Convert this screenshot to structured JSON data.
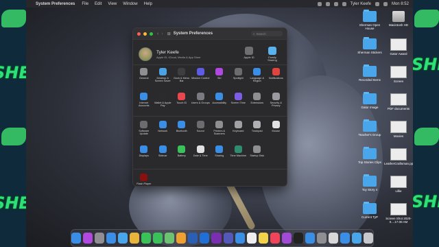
{
  "menubar": {
    "app_name": "System Preferences",
    "menus": [
      "File",
      "Edit",
      "View",
      "Window",
      "Help"
    ],
    "user_name": "Tyler Keefe",
    "clock": "Mon 8:52"
  },
  "overlay_text": "SHERMAN",
  "window": {
    "title": "System Preferences",
    "search_placeholder": "Search",
    "account": {
      "name": "Tyler Keefe",
      "subtitle": "Apple ID, iCloud, Media & App Store",
      "buttons": [
        {
          "label": "Apple ID",
          "icon": "apple-id-icon",
          "color": "#6e6e73"
        },
        {
          "label": "Family Sharing",
          "icon": "family-sharing-icon",
          "color": "#5ab2ee"
        }
      ]
    },
    "rows": [
      [
        {
          "label": "General",
          "icon": "general-icon",
          "color": "#8e8e93"
        },
        {
          "label": "Desktop & Screen Saver",
          "icon": "desktop-screensaver-icon",
          "color": "#4ba3e3"
        },
        {
          "label": "Dock & Menu Bar",
          "icon": "dock-menubar-icon",
          "color": "#3d3d42"
        },
        {
          "label": "Mission Control",
          "icon": "mission-control-icon",
          "color": "#5e5ce6"
        },
        {
          "label": "Siri",
          "icon": "siri-icon",
          "color": "#b148e0"
        },
        {
          "label": "Spotlight",
          "icon": "spotlight-icon",
          "color": "#6b6b70"
        },
        {
          "label": "Language & Region",
          "icon": "language-region-icon",
          "color": "#3a8ee6"
        },
        {
          "label": "Notifications",
          "icon": "notifications-icon",
          "color": "#e0443e"
        }
      ],
      [
        {
          "label": "Internet Accounts",
          "icon": "internet-accounts-icon",
          "color": "#3a8ee6"
        },
        {
          "label": "Wallet & Apple Pay",
          "icon": "wallet-icon",
          "color": "#2b2b2e"
        },
        {
          "label": "Touch ID",
          "icon": "touch-id-icon",
          "color": "#e8484d"
        },
        {
          "label": "Users & Groups",
          "icon": "users-groups-icon",
          "color": "#7a7a80"
        },
        {
          "label": "Accessibility",
          "icon": "accessibility-icon",
          "color": "#3a8ee6"
        },
        {
          "label": "Screen Time",
          "icon": "screen-time-icon",
          "color": "#7d5ce6"
        },
        {
          "label": "Extensions",
          "icon": "extensions-icon",
          "color": "#8e8e93"
        },
        {
          "label": "Security & Privacy",
          "icon": "security-privacy-icon",
          "color": "#9a9aa0"
        }
      ],
      [
        {
          "label": "Software Update",
          "icon": "software-update-icon",
          "color": "#6b6b70"
        },
        {
          "label": "Network",
          "icon": "network-icon",
          "color": "#3a8ee6"
        },
        {
          "label": "Bluetooth",
          "icon": "bluetooth-icon",
          "color": "#3a8ee6"
        },
        {
          "label": "Sound",
          "icon": "sound-icon",
          "color": "#6b6b70"
        },
        {
          "label": "Printers & Scanners",
          "icon": "printers-scanners-icon",
          "color": "#8e8e93"
        },
        {
          "label": "Keyboard",
          "icon": "keyboard-icon",
          "color": "#a0a0a5"
        },
        {
          "label": "Trackpad",
          "icon": "trackpad-icon",
          "color": "#b0b0b5"
        },
        {
          "label": "Mouse",
          "icon": "mouse-icon",
          "color": "#e0e0e5"
        }
      ],
      [
        {
          "label": "Displays",
          "icon": "displays-icon",
          "color": "#3a8ee6"
        },
        {
          "label": "Sidecar",
          "icon": "sidecar-icon",
          "color": "#3a8ee6"
        },
        {
          "label": "Battery",
          "icon": "battery-icon",
          "color": "#3ac15a"
        },
        {
          "label": "Date & Time",
          "icon": "date-time-icon",
          "color": "#e0e0e5"
        },
        {
          "label": "Sharing",
          "icon": "sharing-icon",
          "color": "#3a8ee6"
        },
        {
          "label": "Time Machine",
          "icon": "time-machine-icon",
          "color": "#2f8c6e"
        },
        {
          "label": "Startup Disk",
          "icon": "startup-disk-icon",
          "color": "#8e8e93"
        }
      ],
      [
        {
          "label": "Flash Player",
          "icon": "flash-player-icon",
          "color": "#8a1010"
        }
      ]
    ]
  },
  "desktop_icons": [
    {
      "label": "Sherman Open House",
      "type": "folder"
    },
    {
      "label": "Macintosh HD",
      "type": "disk"
    },
    {
      "label": "Sherman Stickers",
      "type": "folder"
    },
    {
      "label": "Gator Award",
      "type": "thumb"
    },
    {
      "label": "Recorded Items",
      "type": "folder"
    },
    {
      "label": "Screen",
      "type": "thumb"
    },
    {
      "label": "Gator Image",
      "type": "folder"
    },
    {
      "label": "PDF documents",
      "type": "thumb"
    },
    {
      "label": "Teacher's Group",
      "type": "folder"
    },
    {
      "label": "Movies",
      "type": "thumb"
    },
    {
      "label": "Top Stories Clips",
      "type": "folder"
    },
    {
      "label": "LeatherCraftsman.pptx",
      "type": "thumb"
    },
    {
      "label": "Toy Story 4",
      "type": "folder"
    },
    {
      "label": "Lillie",
      "type": "thumb"
    },
    {
      "label": "Current TyP",
      "type": "folder"
    },
    {
      "label": "Screen Shot 2020-0....17.00 AM",
      "type": "thumb"
    }
  ],
  "dock": [
    {
      "icon": "finder-icon",
      "color": "#3a8ee6"
    },
    {
      "icon": "siri-icon",
      "color": "#b148e0"
    },
    {
      "icon": "launchpad-icon",
      "color": "#8e8e93"
    },
    {
      "icon": "safari-icon",
      "color": "#3a8ee6"
    },
    {
      "icon": "mail-icon",
      "color": "#4aa6ea"
    },
    {
      "icon": "chrome-icon",
      "color": "#e8b53a"
    },
    {
      "icon": "messages-icon",
      "color": "#3ac15a"
    },
    {
      "icon": "facetime-icon",
      "color": "#3ac15a"
    },
    {
      "icon": "maps-icon",
      "color": "#6cc270"
    },
    {
      "icon": "photos-icon",
      "color": "#f0a030"
    },
    {
      "icon": "word-icon",
      "color": "#2b5fb4"
    },
    {
      "icon": "outlook-icon",
      "color": "#1f6fd6"
    },
    {
      "icon": "onenote-icon",
      "color": "#7a2fb0"
    },
    {
      "icon": "teams-icon",
      "color": "#5458b8"
    },
    {
      "icon": "messenger-icon",
      "color": "#3a8ee6"
    },
    {
      "icon": "calendar-icon",
      "color": "#eeeeee"
    },
    {
      "icon": "notes-icon",
      "color": "#f2d24a"
    },
    {
      "icon": "music-icon",
      "color": "#f0445a"
    },
    {
      "icon": "podcasts-icon",
      "color": "#a04ad6"
    },
    {
      "icon": "tv-icon",
      "color": "#222222"
    },
    {
      "icon": "appstore-icon",
      "color": "#3a8ee6"
    },
    {
      "icon": "system-preferences-icon",
      "color": "#8e8e93"
    },
    {
      "icon": "preview-icon",
      "color": "#d8d8d8"
    },
    {
      "icon": "zoom-icon",
      "color": "#3a8ee6"
    },
    {
      "icon": "downloads-icon",
      "color": "#4aa6ea"
    },
    {
      "icon": "trash-icon",
      "color": "#c8c8cc"
    }
  ]
}
